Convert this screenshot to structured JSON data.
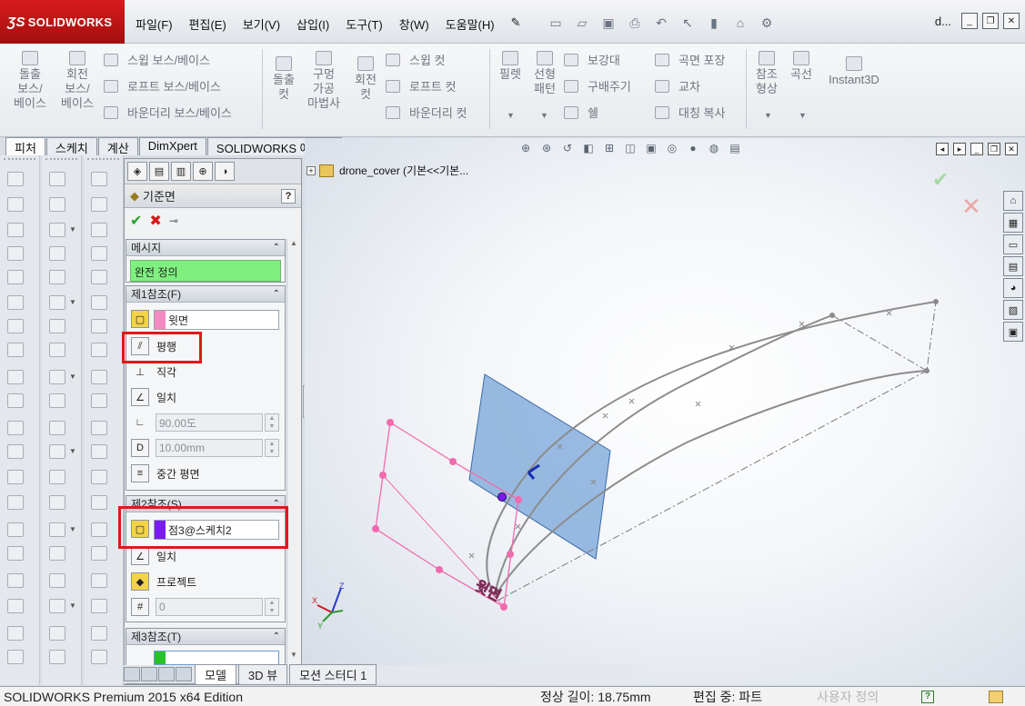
{
  "app": {
    "brand": "SOLIDWORKS",
    "doc_title": "d..."
  },
  "menu": [
    "파일(F)",
    "편집(E)",
    "보기(V)",
    "삽입(I)",
    "도구(T)",
    "창(W)",
    "도움말(H)"
  ],
  "ribbon": {
    "extrude_boss": "돌출\n보스/\n베이스",
    "revolve_boss": "회전\n보스/\n베이스",
    "sweep_boss": "스윕 보스/베이스",
    "loft_boss": "로프트 보스/베이스",
    "boundary_boss": "바운더리 보스/베이스",
    "extrude_cut": "돌출\n컷",
    "hole_wizard": "구멍\n가공\n마법사",
    "revolve_cut": "회전\n컷",
    "sweep_cut": "스윕 컷",
    "loft_cut": "로프트 컷",
    "boundary_cut": "바운더리 컷",
    "fillet": "필렛",
    "linear_pattern": "선형\n패턴",
    "rib": "보강대",
    "draft": "구배주기",
    "shell": "쉘",
    "wrap": "곡면 포장",
    "intersect": "교차",
    "mirror": "대칭 복사",
    "ref_geometry": "참조\n형상",
    "curves": "곡선",
    "instant3d": "Instant3D"
  },
  "cm_tabs": [
    "피처",
    "스케치",
    "계산",
    "DimXpert",
    "SOLIDWORKS 애드인"
  ],
  "pm": {
    "title": "기준면",
    "help": "?",
    "message": {
      "header": "메시지",
      "text": "완전 정의"
    },
    "ref1": {
      "header": "제1참조(F)",
      "selection": "윗면",
      "swatch": "#f48ac2",
      "parallel": "평행",
      "perpendicular": "직각",
      "coincident": "일치",
      "angle": "90.00도",
      "offset": "10.00mm",
      "mid_plane": "중간 평면"
    },
    "ref2": {
      "header": "제2참조(S)",
      "selection": "점3@스케치2",
      "swatch": "#7a1cf0",
      "coincident": "일치",
      "project": "프로젝트",
      "count": "0"
    },
    "ref3": {
      "header": "제3참조(T)",
      "swatch": "#27c227"
    }
  },
  "tree": {
    "item": "drone_cover  (기본<<기본..."
  },
  "viewport": {
    "label": "윗면",
    "plane_color": "#6f9ed6"
  },
  "bottom_tabs": [
    "모델",
    "3D 뷰",
    "모션 스터디 1"
  ],
  "status": {
    "edition": "SOLIDWORKS Premium 2015 x64 Edition",
    "measure": "정상 길이: 18.75mm",
    "editing": "편집 중: 파트",
    "custom": "사용자 정의",
    "help": "?"
  }
}
